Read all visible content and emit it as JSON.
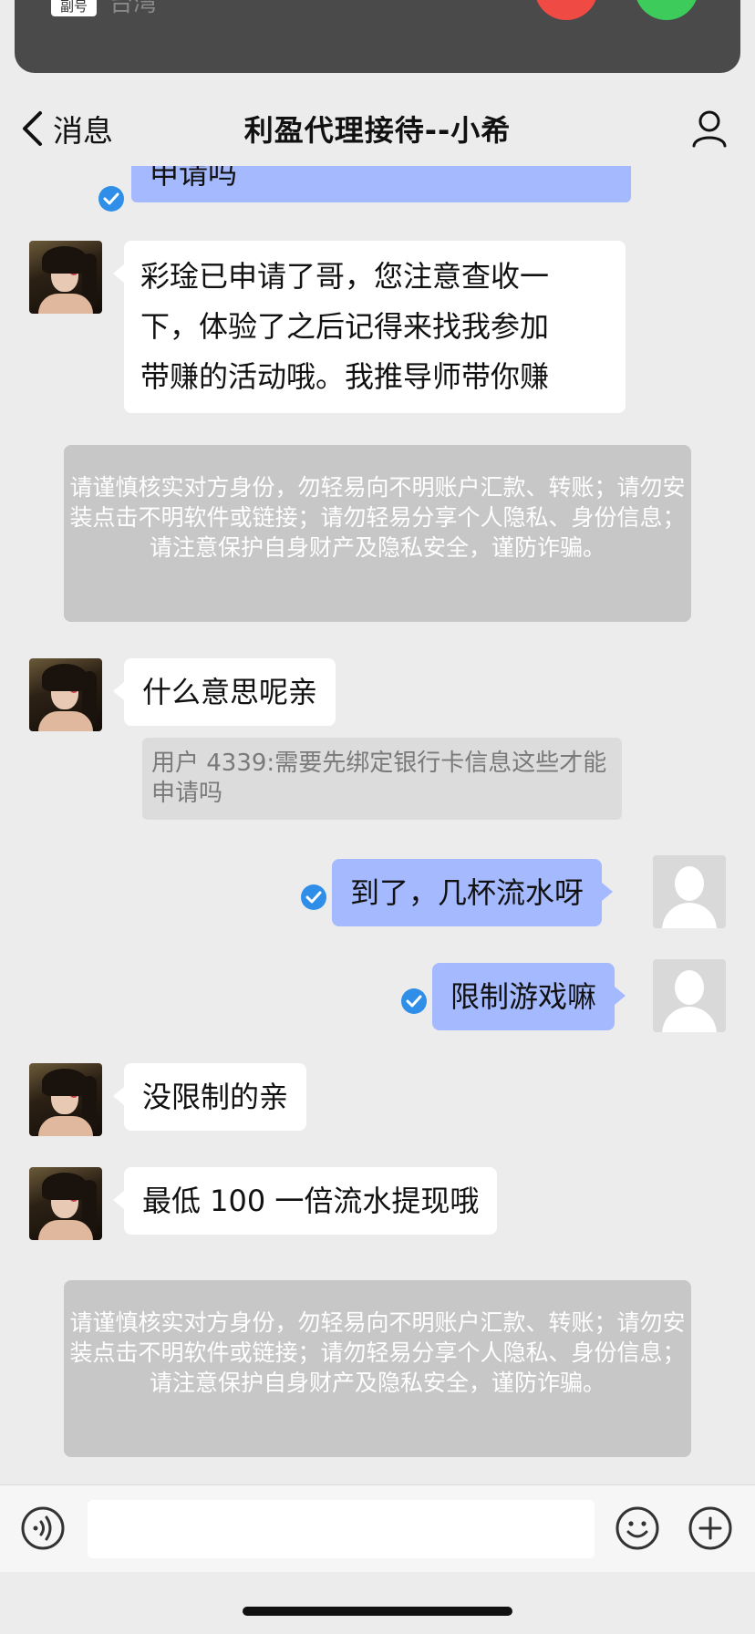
{
  "call_banner": {
    "badge": "副号",
    "region": "台湾",
    "colors": {
      "decline": "#f04a45",
      "accept": "#3dcb5b"
    }
  },
  "nav": {
    "back_label": "消息",
    "title": "利盈代理接待--小希",
    "icons": {
      "back": "chevron-left-icon",
      "profile": "person-icon"
    }
  },
  "messages": [
    {
      "side": "out",
      "text": "申请吗",
      "status": "sent-check"
    },
    {
      "side": "in",
      "lines": [
        "彩琻已申请了哥，您注意查收一",
        "下，体验了之后记得来找我参加",
        "带赚的活动哦。我推导师带你赚"
      ]
    },
    {
      "side": "in",
      "text": "什么意思呢亲",
      "quote": "用户 4339:需要先绑定银行卡信息这些才能申请吗"
    },
    {
      "side": "out",
      "text": "到了，几杯流水呀",
      "status": "sent-check"
    },
    {
      "side": "out",
      "text": "限制游戏嘛",
      "status": "sent-check"
    },
    {
      "side": "in",
      "text": "没限制的亲"
    },
    {
      "side": "in",
      "text": "最低 100 一倍流水提现哦"
    }
  ],
  "warnings": [
    "请谨慎核实对方身份，勿轻易向不明账户汇款、转账；请勿安装点击不明软件或链接；请勿轻易分享个人隐私、身份信息；请注意保护自身财产及隐私安全，谨防诈骗。",
    "请谨慎核实对方身份，勿轻易向不明账户汇款、转账；请勿安装点击不明软件或链接；请勿轻易分享个人隐私、身份信息；请注意保护自身财产及隐私安全，谨防诈骗。"
  ],
  "input_bar": {
    "value": "",
    "icons": {
      "voice": "voice-icon",
      "emoji": "emoji-icon",
      "plus": "plus-icon"
    }
  },
  "colors": {
    "outgoing_bubble": "#a5b9ff",
    "incoming_bubble": "#ffffff",
    "check": "#2f8fe8",
    "background": "#ececec"
  }
}
